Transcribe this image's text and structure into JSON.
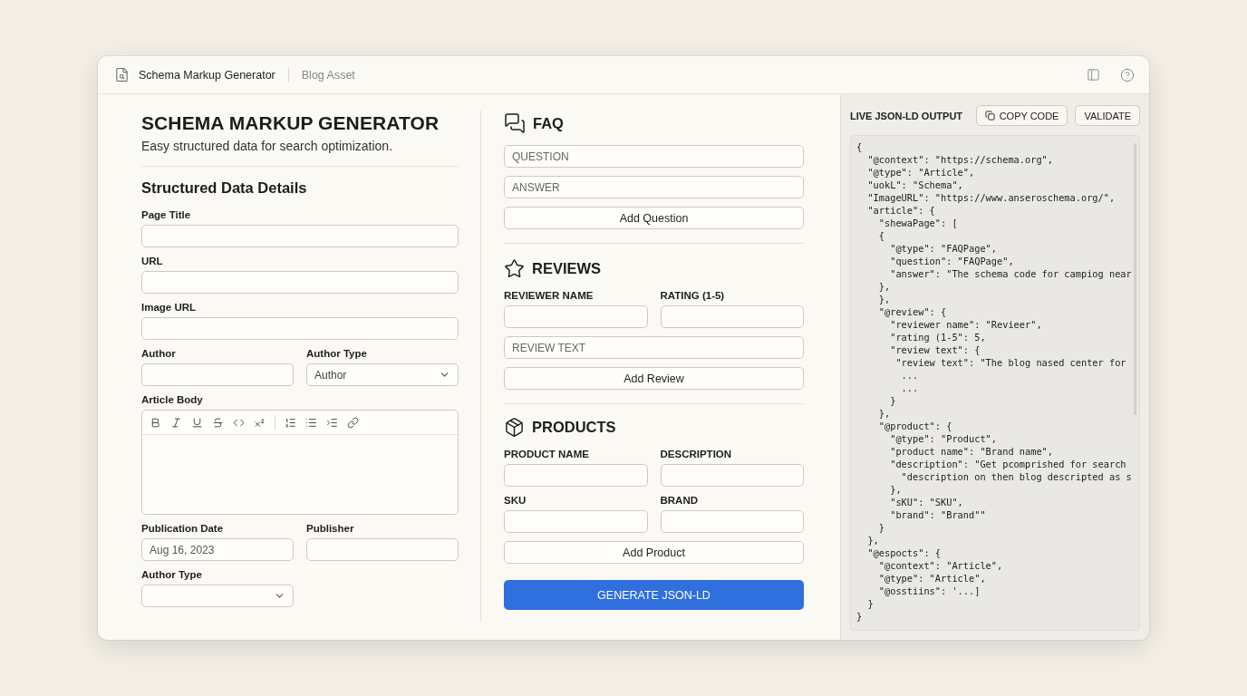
{
  "window": {
    "title": "Schema Markup Generator",
    "breadcrumb": "Blog Asset"
  },
  "form": {
    "title": "SCHEMA MARKUP GENERATOR",
    "subtitle": "Easy structured data for search optimization.",
    "section_title": "Structured Data Details",
    "fields": [
      {
        "label": "Page Title",
        "kind": "text",
        "wide": true
      },
      {
        "label": "URL",
        "kind": "text",
        "wide": true
      },
      {
        "label": "Image URL",
        "kind": "text",
        "wide": true
      },
      {
        "label": "Author",
        "kind": "text",
        "wide": false
      },
      {
        "label": "Author Type",
        "kind": "select",
        "wide": false,
        "value": "Author"
      },
      {
        "label": "Article Body",
        "kind": "editor",
        "wide": true
      },
      {
        "label": "Publication Date",
        "kind": "text",
        "wide": false,
        "value": "Aug 16, 2023"
      },
      {
        "label": "Publisher",
        "kind": "text",
        "wide": false
      },
      {
        "label": "Author Type",
        "kind": "select",
        "wide": false
      }
    ]
  },
  "faq": {
    "title": "FAQ",
    "question_placeholder": "QUESTION",
    "answer_placeholder": "ANSWER",
    "button": "Add Question"
  },
  "reviews": {
    "title": "REVIEWS",
    "fields": [
      "REVIEWER NAME",
      "RATING (1-5)"
    ],
    "text_placeholder": "REVIEW TEXT",
    "button": "Add Review"
  },
  "products": {
    "title": "PRODUCTS",
    "fields": [
      "PRODUCT NAME",
      "DESCRIPTION",
      "SKU",
      "BRAND"
    ],
    "button": "Add Product"
  },
  "generate_button": "GENERATE JSON-LD",
  "output": {
    "title": "LIVE JSON-LD OUTPUT",
    "copy_button": "COPY CODE",
    "validate_button": "VALIDATE",
    "lines": [
      "{",
      "  \"@context\": \"https://schema.org\",",
      "  \"@type\": \"Article\",",
      "  \"uokL\": \"Schema\",",
      "  \"ImageURL\": \"https://www.anseroschema.org/\",",
      "  \"article\": {",
      "    \"shewaPage\": [",
      "    {",
      "      \"@type\": \"FAQPage\",",
      "      \"question\": \"FAQPage\",",
      "      \"answer\": \"The schema code for campiog near",
      "    },",
      "    },",
      "    \"@review\": {",
      "      \"reviewer name\": \"Revieer\",",
      "      \"rating (1-5\": 5,",
      "      \"review text\": {",
      "       \"review text\": \"The blog nased center for",
      "        ...",
      "        ...",
      "      }",
      "    },",
      "    \"@product\": {",
      "      \"@type\": \"Product\",",
      "      \"product name\": \"Brand name\",",
      "      \"description\": \"Get pcomprished for search",
      "        \"description on then blog descripted as s",
      "      },",
      "      \"sKU\": \"SKU\",",
      "      \"brand\": \"Brand\"\"",
      "    }",
      "  },",
      "  \"@espocts\": {",
      "    \"@context\": \"Article\",",
      "    \"@type\": \"Article\",",
      "    \"@osstiins\": '...]",
      "  }",
      "}"
    ]
  }
}
